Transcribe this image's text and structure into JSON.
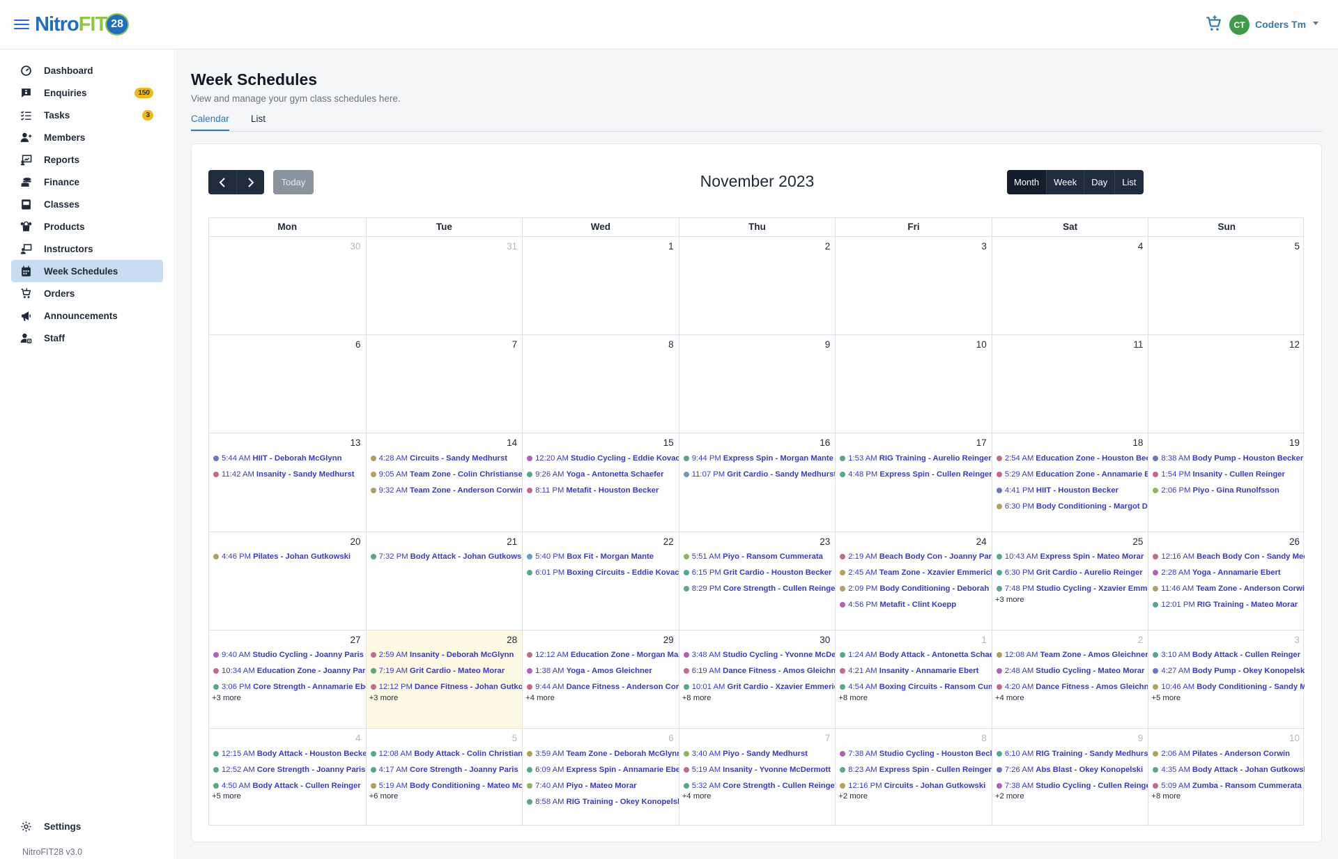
{
  "app": {
    "logo": {
      "nitro": "Nitro",
      "fit": "FIT",
      "num": "28"
    },
    "user": {
      "initials": "CT",
      "name": "Coders Tm"
    },
    "version": "NitroFIT28 v3.0"
  },
  "sidebar": {
    "items": [
      {
        "label": "Dashboard",
        "icon": "dashboard-icon"
      },
      {
        "label": "Enquiries",
        "icon": "enquiries-icon",
        "badge": "150"
      },
      {
        "label": "Tasks",
        "icon": "tasks-icon",
        "badge": "3"
      },
      {
        "label": "Members",
        "icon": "members-icon"
      },
      {
        "label": "Reports",
        "icon": "reports-icon"
      },
      {
        "label": "Finance",
        "icon": "finance-icon"
      },
      {
        "label": "Classes",
        "icon": "classes-icon"
      },
      {
        "label": "Products",
        "icon": "products-icon"
      },
      {
        "label": "Instructors",
        "icon": "instructors-icon"
      },
      {
        "label": "Week Schedules",
        "icon": "calendar-icon",
        "active": true
      },
      {
        "label": "Orders",
        "icon": "orders-icon"
      },
      {
        "label": "Announcements",
        "icon": "megaphone-icon"
      },
      {
        "label": "Staff",
        "icon": "staff-icon"
      }
    ],
    "settings_label": "Settings"
  },
  "page": {
    "title": "Week Schedules",
    "subtitle": "View and manage your gym class schedules here.",
    "tabs": [
      "Calendar",
      "List"
    ]
  },
  "calendar": {
    "title": "November 2023",
    "today_label": "Today",
    "views": [
      "Month",
      "Week",
      "Day",
      "List"
    ],
    "active_view": "Month",
    "days_of_week": [
      "Mon",
      "Tue",
      "Wed",
      "Thu",
      "Fri",
      "Sat",
      "Sun"
    ],
    "weeks": [
      [
        {
          "day": "30",
          "other": true,
          "events": []
        },
        {
          "day": "31",
          "other": true,
          "events": []
        },
        {
          "day": "1",
          "events": []
        },
        {
          "day": "2",
          "events": []
        },
        {
          "day": "3",
          "events": []
        },
        {
          "day": "4",
          "events": []
        },
        {
          "day": "5",
          "events": []
        }
      ],
      [
        {
          "day": "6",
          "events": []
        },
        {
          "day": "7",
          "events": []
        },
        {
          "day": "8",
          "events": []
        },
        {
          "day": "9",
          "events": []
        },
        {
          "day": "10",
          "events": []
        },
        {
          "day": "11",
          "events": []
        },
        {
          "day": "12",
          "events": []
        }
      ],
      [
        {
          "day": "13",
          "events": [
            {
              "time": "5:44 AM",
              "title": "HIIT - Deborah McGlynn",
              "color": "#6b77c9"
            },
            {
              "time": "11:42 AM",
              "title": "Insanity - Sandy Medhurst",
              "color": "#c46a88"
            }
          ]
        },
        {
          "day": "14",
          "events": [
            {
              "time": "4:28 AM",
              "title": "Circuits - Sandy Medhurst",
              "color": "#b0a064"
            },
            {
              "time": "9:05 AM",
              "title": "Team Zone - Colin Christiansen",
              "color": "#b0a064"
            },
            {
              "time": "9:32 AM",
              "title": "Team Zone - Anderson Corwin",
              "color": "#b0a064"
            }
          ]
        },
        {
          "day": "15",
          "events": [
            {
              "time": "12:20 AM",
              "title": "Studio Cycling - Eddie Kovacek",
              "color": "#b062b8"
            },
            {
              "time": "9:26 AM",
              "title": "Yoga - Antonetta Schaefer",
              "color": "#5aa882"
            },
            {
              "time": "8:11 PM",
              "title": "Metafit - Houston Becker",
              "color": "#c46a88"
            }
          ]
        },
        {
          "day": "16",
          "events": [
            {
              "time": "9:44 PM",
              "title": "Express Spin - Morgan Mante",
              "color": "#5aa882"
            },
            {
              "time": "11:07 PM",
              "title": "Grit Cardio - Sandy Medhurst",
              "color": "#6a9ac8"
            }
          ]
        },
        {
          "day": "17",
          "events": [
            {
              "time": "1:53 AM",
              "title": "RIG Training - Aurelio Reinger",
              "color": "#5aa882"
            },
            {
              "time": "4:48 PM",
              "title": "Express Spin - Cullen Reinger",
              "color": "#5aa882"
            }
          ]
        },
        {
          "day": "18",
          "events": [
            {
              "time": "2:54 AM",
              "title": "Education Zone - Houston Becker",
              "color": "#c46a88"
            },
            {
              "time": "5:29 AM",
              "title": "Education Zone - Annamarie Ebert",
              "color": "#c46a88"
            },
            {
              "time": "4:41 PM",
              "title": "HIIT - Houston Becker",
              "color": "#6b77c9"
            },
            {
              "time": "6:30 PM",
              "title": "Body Conditioning - Margot Dare",
              "color": "#b0a064"
            }
          ]
        },
        {
          "day": "19",
          "events": [
            {
              "time": "8:38 AM",
              "title": "Body Pump - Houston Becker",
              "color": "#6b77c9"
            },
            {
              "time": "1:54 PM",
              "title": "Insanity - Cullen Reinger",
              "color": "#c46a88"
            },
            {
              "time": "2:06 PM",
              "title": "Piyo - Gina Runolfsson",
              "color": "#8db85a"
            }
          ]
        }
      ],
      [
        {
          "day": "20",
          "events": [
            {
              "time": "4:46 PM",
              "title": "Pilates - Johan Gutkowski",
              "color": "#b0a064"
            }
          ]
        },
        {
          "day": "21",
          "events": [
            {
              "time": "7:32 PM",
              "title": "Body Attack - Johan Gutkowski",
              "color": "#5aa882"
            }
          ]
        },
        {
          "day": "22",
          "events": [
            {
              "time": "5:40 PM",
              "title": "Box Fit - Morgan Mante",
              "color": "#6a9ac8"
            },
            {
              "time": "6:01 PM",
              "title": "Boxing Circuits - Eddie Kovacek",
              "color": "#5aa882"
            }
          ]
        },
        {
          "day": "23",
          "events": [
            {
              "time": "5:51 AM",
              "title": "Piyo - Ransom Cummerata",
              "color": "#8db85a"
            },
            {
              "time": "6:15 PM",
              "title": "Grit Cardio - Houston Becker",
              "color": "#5aa882"
            },
            {
              "time": "8:29 PM",
              "title": "Core Strength - Cullen Reinger",
              "color": "#5aa882"
            }
          ]
        },
        {
          "day": "24",
          "events": [
            {
              "time": "2:19 AM",
              "title": "Beach Body Con - Joanny Paris",
              "color": "#c46a88"
            },
            {
              "time": "2:45 AM",
              "title": "Team Zone - Xzavier Emmerich",
              "color": "#b0a064"
            },
            {
              "time": "2:09 PM",
              "title": "Body Conditioning - Deborah McGlynn",
              "color": "#b0a064"
            },
            {
              "time": "4:56 PM",
              "title": "Metafit - Clint Koepp",
              "color": "#b062b8"
            }
          ]
        },
        {
          "day": "25",
          "events": [
            {
              "time": "10:43 AM",
              "title": "Express Spin - Mateo Morar",
              "color": "#5aa882"
            },
            {
              "time": "6:30 PM",
              "title": "Grit Cardio - Aurelio Reinger",
              "color": "#5aa882"
            },
            {
              "time": "7:48 PM",
              "title": "Studio Cycling - Xzavier Emmerich",
              "color": "#5aa882"
            }
          ],
          "more": "+3 more"
        },
        {
          "day": "26",
          "events": [
            {
              "time": "12:16 AM",
              "title": "Beach Body Con - Sandy Medhurst",
              "color": "#c46a88"
            },
            {
              "time": "2:28 AM",
              "title": "Yoga - Annamarie Ebert",
              "color": "#b062b8"
            },
            {
              "time": "11:46 AM",
              "title": "Team Zone - Anderson Corwin",
              "color": "#b0a064"
            },
            {
              "time": "12:01 PM",
              "title": "RIG Training - Mateo Morar",
              "color": "#5aa882"
            }
          ]
        }
      ],
      [
        {
          "day": "27",
          "events": [
            {
              "time": "9:40 AM",
              "title": "Studio Cycling - Joanny Paris",
              "color": "#b062b8"
            },
            {
              "time": "10:34 AM",
              "title": "Education Zone - Joanny Paris",
              "color": "#c46a88"
            },
            {
              "time": "3:06 PM",
              "title": "Core Strength - Annamarie Ebert",
              "color": "#5aa882"
            }
          ],
          "more": "+3 more"
        },
        {
          "day": "28",
          "today": true,
          "events": [
            {
              "time": "2:59 AM",
              "title": "Insanity - Deborah McGlynn",
              "color": "#c46a88"
            },
            {
              "time": "7:19 AM",
              "title": "Grit Cardio - Mateo Morar",
              "color": "#5aa882"
            },
            {
              "time": "12:12 PM",
              "title": "Dance Fitness - Johan Gutkowski",
              "color": "#c46a88"
            }
          ],
          "more": "+3 more"
        },
        {
          "day": "29",
          "events": [
            {
              "time": "12:12 AM",
              "title": "Education Zone - Morgan Mante",
              "color": "#c46a88"
            },
            {
              "time": "1:38 AM",
              "title": "Yoga - Amos Gleichner",
              "color": "#b062b8"
            },
            {
              "time": "9:44 AM",
              "title": "Dance Fitness - Anderson Corwin",
              "color": "#c46a88"
            }
          ],
          "more": "+4 more"
        },
        {
          "day": "30",
          "events": [
            {
              "time": "3:48 AM",
              "title": "Studio Cycling - Yvonne McDermott",
              "color": "#b062b8"
            },
            {
              "time": "6:19 AM",
              "title": "Dance Fitness - Amos Gleichner",
              "color": "#c46a88"
            },
            {
              "time": "10:01 AM",
              "title": "Grit Cardio - Xzavier Emmerich",
              "color": "#5aa882"
            }
          ],
          "more": "+8 more"
        },
        {
          "day": "1",
          "other": true,
          "events": [
            {
              "time": "1:24 AM",
              "title": "Body Attack - Antonetta Schaefer",
              "color": "#5aa882"
            },
            {
              "time": "4:21 AM",
              "title": "Insanity - Annamarie Ebert",
              "color": "#c46a88"
            },
            {
              "time": "4:54 AM",
              "title": "Boxing Circuits - Ransom Cummerata",
              "color": "#5aa882"
            }
          ],
          "more": "+8 more"
        },
        {
          "day": "2",
          "other": true,
          "events": [
            {
              "time": "12:08 AM",
              "title": "Team Zone - Amos Gleichner",
              "color": "#b0a064"
            },
            {
              "time": "2:48 AM",
              "title": "Studio Cycling - Mateo Morar",
              "color": "#b062b8"
            },
            {
              "time": "4:20 AM",
              "title": "Dance Fitness - Amos Gleichner",
              "color": "#c46a88"
            }
          ],
          "more": "+4 more"
        },
        {
          "day": "3",
          "other": true,
          "events": [
            {
              "time": "3:10 AM",
              "title": "Body Attack - Cullen Reinger",
              "color": "#5aa882"
            },
            {
              "time": "4:27 AM",
              "title": "Body Pump - Okey Konopelski",
              "color": "#6b77c9"
            },
            {
              "time": "10:46 AM",
              "title": "Body Conditioning - Sandy Medhurst",
              "color": "#b0a064"
            }
          ],
          "more": "+5 more"
        }
      ],
      [
        {
          "day": "4",
          "other": true,
          "events": [
            {
              "time": "12:15 AM",
              "title": "Body Attack - Houston Becker",
              "color": "#5aa882"
            },
            {
              "time": "12:52 AM",
              "title": "Core Strength - Joanny Paris",
              "color": "#5aa882"
            },
            {
              "time": "4:50 AM",
              "title": "Body Attack - Cullen Reinger",
              "color": "#5aa882"
            }
          ],
          "more": "+5 more"
        },
        {
          "day": "5",
          "other": true,
          "events": [
            {
              "time": "12:08 AM",
              "title": "Body Attack - Colin Christiansen",
              "color": "#5aa882"
            },
            {
              "time": "4:17 AM",
              "title": "Core Strength - Joanny Paris",
              "color": "#5aa882"
            },
            {
              "time": "5:19 AM",
              "title": "Body Conditioning - Mateo Morar",
              "color": "#b0a064"
            }
          ],
          "more": "+6 more"
        },
        {
          "day": "6",
          "other": true,
          "events": [
            {
              "time": "3:59 AM",
              "title": "Team Zone - Deborah McGlynn",
              "color": "#b0a064"
            },
            {
              "time": "6:09 AM",
              "title": "Express Spin - Annamarie Ebert",
              "color": "#5aa882"
            },
            {
              "time": "7:40 AM",
              "title": "Piyo - Mateo Morar",
              "color": "#8db85a"
            },
            {
              "time": "8:58 AM",
              "title": "RIG Training - Okey Konopelski",
              "color": "#5aa882"
            }
          ]
        },
        {
          "day": "7",
          "other": true,
          "events": [
            {
              "time": "3:40 AM",
              "title": "Piyo - Sandy Medhurst",
              "color": "#8db85a"
            },
            {
              "time": "5:19 AM",
              "title": "Insanity - Yvonne McDermott",
              "color": "#c46a88"
            },
            {
              "time": "5:32 AM",
              "title": "Core Strength - Cullen Reinger",
              "color": "#5aa882"
            }
          ],
          "more": "+4 more"
        },
        {
          "day": "8",
          "other": true,
          "events": [
            {
              "time": "7:38 AM",
              "title": "Studio Cycling - Houston Becker",
              "color": "#b062b8"
            },
            {
              "time": "8:23 AM",
              "title": "Express Spin - Cullen Reinger",
              "color": "#5aa882"
            },
            {
              "time": "12:16 PM",
              "title": "Circuits - Johan Gutkowski",
              "color": "#b0a064"
            }
          ],
          "more": "+2 more"
        },
        {
          "day": "9",
          "other": true,
          "events": [
            {
              "time": "6:10 AM",
              "title": "RIG Training - Sandy Medhurst",
              "color": "#5aa882"
            },
            {
              "time": "7:26 AM",
              "title": "Abs Blast - Okey Konopelski",
              "color": "#6b77c9"
            },
            {
              "time": "7:38 AM",
              "title": "Studio Cycling - Cullen Reinger",
              "color": "#b062b8"
            }
          ],
          "more": "+2 more"
        },
        {
          "day": "10",
          "other": true,
          "events": [
            {
              "time": "2:06 AM",
              "title": "Pilates - Anderson Corwin",
              "color": "#b0a064"
            },
            {
              "time": "4:35 AM",
              "title": "Body Attack - Johan Gutkowski",
              "color": "#5aa882"
            },
            {
              "time": "5:09 AM",
              "title": "Zumba - Ransom Cummerata",
              "color": "#c46a88"
            }
          ],
          "more": "+8 more"
        }
      ]
    ]
  }
}
